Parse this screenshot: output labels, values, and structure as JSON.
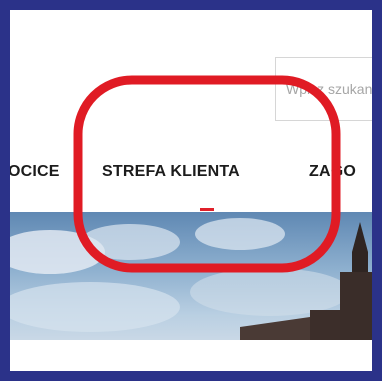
{
  "search": {
    "placeholder": "Wpisz szukaną frazę"
  },
  "nav": {
    "prev_label": "OCICE",
    "active_label": "STREFA KLIENTA",
    "next_label": "ZAGO"
  },
  "colors": {
    "outer_border": "#2b3289",
    "active_indicator": "#e0202a",
    "annotation": "#e01b24"
  }
}
